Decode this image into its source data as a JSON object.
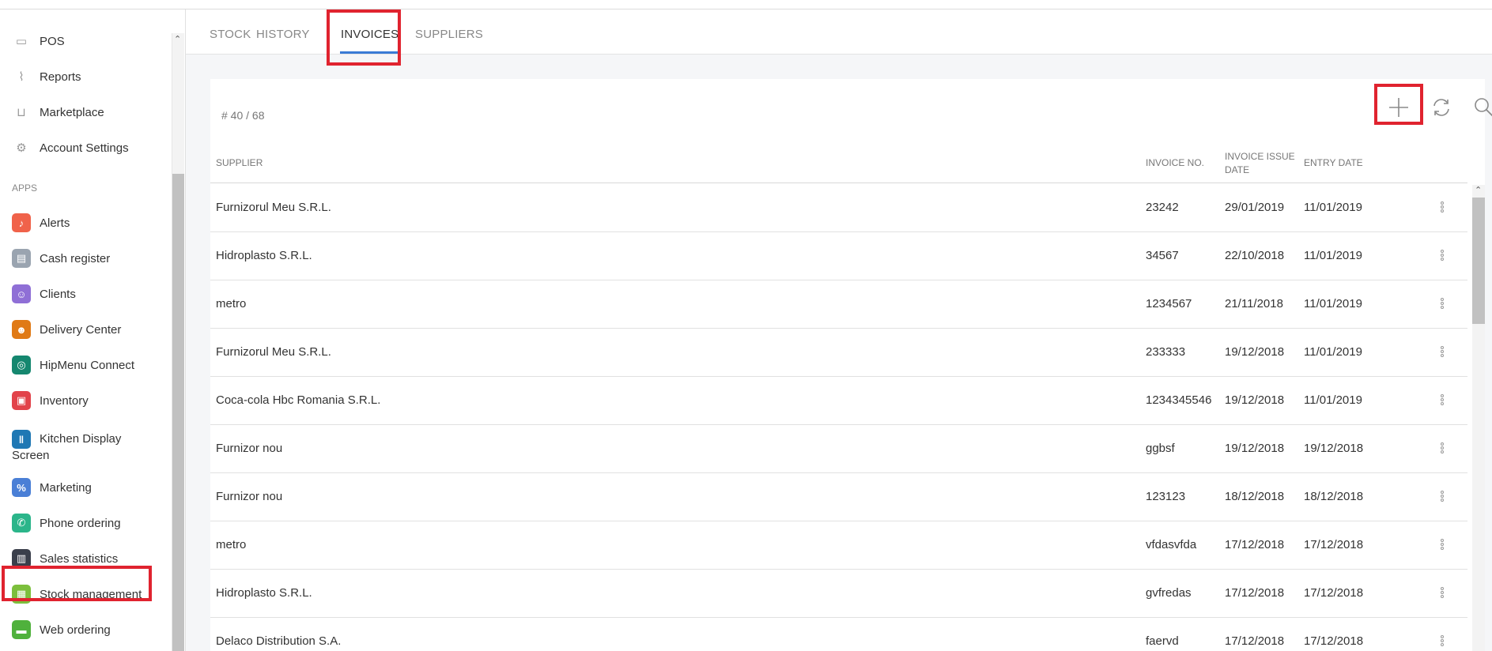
{
  "sidebar": {
    "top_items": [
      {
        "label": "POS",
        "icon": "monitor-icon"
      },
      {
        "label": "Reports",
        "icon": "chart-icon"
      },
      {
        "label": "Marketplace",
        "icon": "cart-icon"
      },
      {
        "label": "Account Settings",
        "icon": "gear-icon"
      }
    ],
    "apps_heading": "APPS",
    "apps": [
      {
        "label": "Alerts",
        "icon": "bell-icon",
        "color": "#f0624a"
      },
      {
        "label": "Cash register",
        "icon": "cash-register-icon",
        "color": "#9aa4b0"
      },
      {
        "label": "Clients",
        "icon": "users-icon",
        "color": "#8f6fd6"
      },
      {
        "label": "Delivery Center",
        "icon": "courier-icon",
        "color": "#e07a16"
      },
      {
        "label": "HipMenu Connect",
        "icon": "hipmenu-icon",
        "color": "#15876f"
      },
      {
        "label": "Inventory",
        "icon": "inventory-icon",
        "color": "#e2434a"
      },
      {
        "label": "Kitchen Display",
        "label2": "Screen",
        "icon": "cutlery-icon",
        "color": "#1f78b4"
      },
      {
        "label": "Marketing",
        "icon": "percent-icon",
        "color": "#4a7fd6"
      },
      {
        "label": "Phone ordering",
        "icon": "phone-icon",
        "color": "#2bb58a"
      },
      {
        "label": "Sales statistics",
        "icon": "bar-stats-icon",
        "color": "#3a3f4b"
      },
      {
        "label": "Stock management",
        "icon": "stock-icon",
        "color": "#7cbf3c"
      },
      {
        "label": "Web ordering",
        "icon": "web-icon",
        "color": "#4fb13c"
      }
    ]
  },
  "tabs": [
    {
      "label": "STOCK"
    },
    {
      "label": "HISTORY"
    },
    {
      "label": "INVOICES"
    },
    {
      "label": "SUPPLIERS"
    }
  ],
  "active_tab": "INVOICES",
  "toolbar": {
    "count": "# 40 / 68",
    "add_glyph": "+",
    "refresh_glyph": "⟳",
    "search_glyph": "⌕"
  },
  "table": {
    "headers": {
      "supplier": "SUPPLIER",
      "invoice_no": "INVOICE NO.",
      "issue_date_1": "INVOICE ISSUE",
      "issue_date_2": "DATE",
      "entry_date": "ENTRY DATE"
    },
    "rows": [
      {
        "supplier": "Furnizorul Meu S.R.L.",
        "invoice_no": "23242",
        "issue_date": "29/01/2019",
        "entry_date": "11/01/2019"
      },
      {
        "supplier": "Hidroplasto S.R.L.",
        "invoice_no": "34567",
        "issue_date": "22/10/2018",
        "entry_date": "11/01/2019"
      },
      {
        "supplier": "metro",
        "invoice_no": "1234567",
        "issue_date": "21/11/2018",
        "entry_date": "11/01/2019"
      },
      {
        "supplier": "Furnizorul Meu S.R.L.",
        "invoice_no": "233333",
        "issue_date": "19/12/2018",
        "entry_date": "11/01/2019"
      },
      {
        "supplier": "Coca-cola Hbc Romania S.R.L.",
        "invoice_no": "1234345546",
        "issue_date": "19/12/2018",
        "entry_date": "11/01/2019"
      },
      {
        "supplier": "Furnizor nou",
        "invoice_no": "ggbsf",
        "issue_date": "19/12/2018",
        "entry_date": "19/12/2018"
      },
      {
        "supplier": "Furnizor nou",
        "invoice_no": "123123",
        "issue_date": "18/12/2018",
        "entry_date": "18/12/2018"
      },
      {
        "supplier": "metro",
        "invoice_no": "vfdasvfda",
        "issue_date": "17/12/2018",
        "entry_date": "17/12/2018"
      },
      {
        "supplier": "Hidroplasto S.R.L.",
        "invoice_no": "gvfredas",
        "issue_date": "17/12/2018",
        "entry_date": "17/12/2018"
      },
      {
        "supplier": "Delaco Distribution S.A.",
        "invoice_no": "faervd",
        "issue_date": "17/12/2018",
        "entry_date": "17/12/2018"
      }
    ]
  },
  "colors": {
    "highlight": "#e0232f",
    "tab_underline": "#3a7bd5"
  }
}
